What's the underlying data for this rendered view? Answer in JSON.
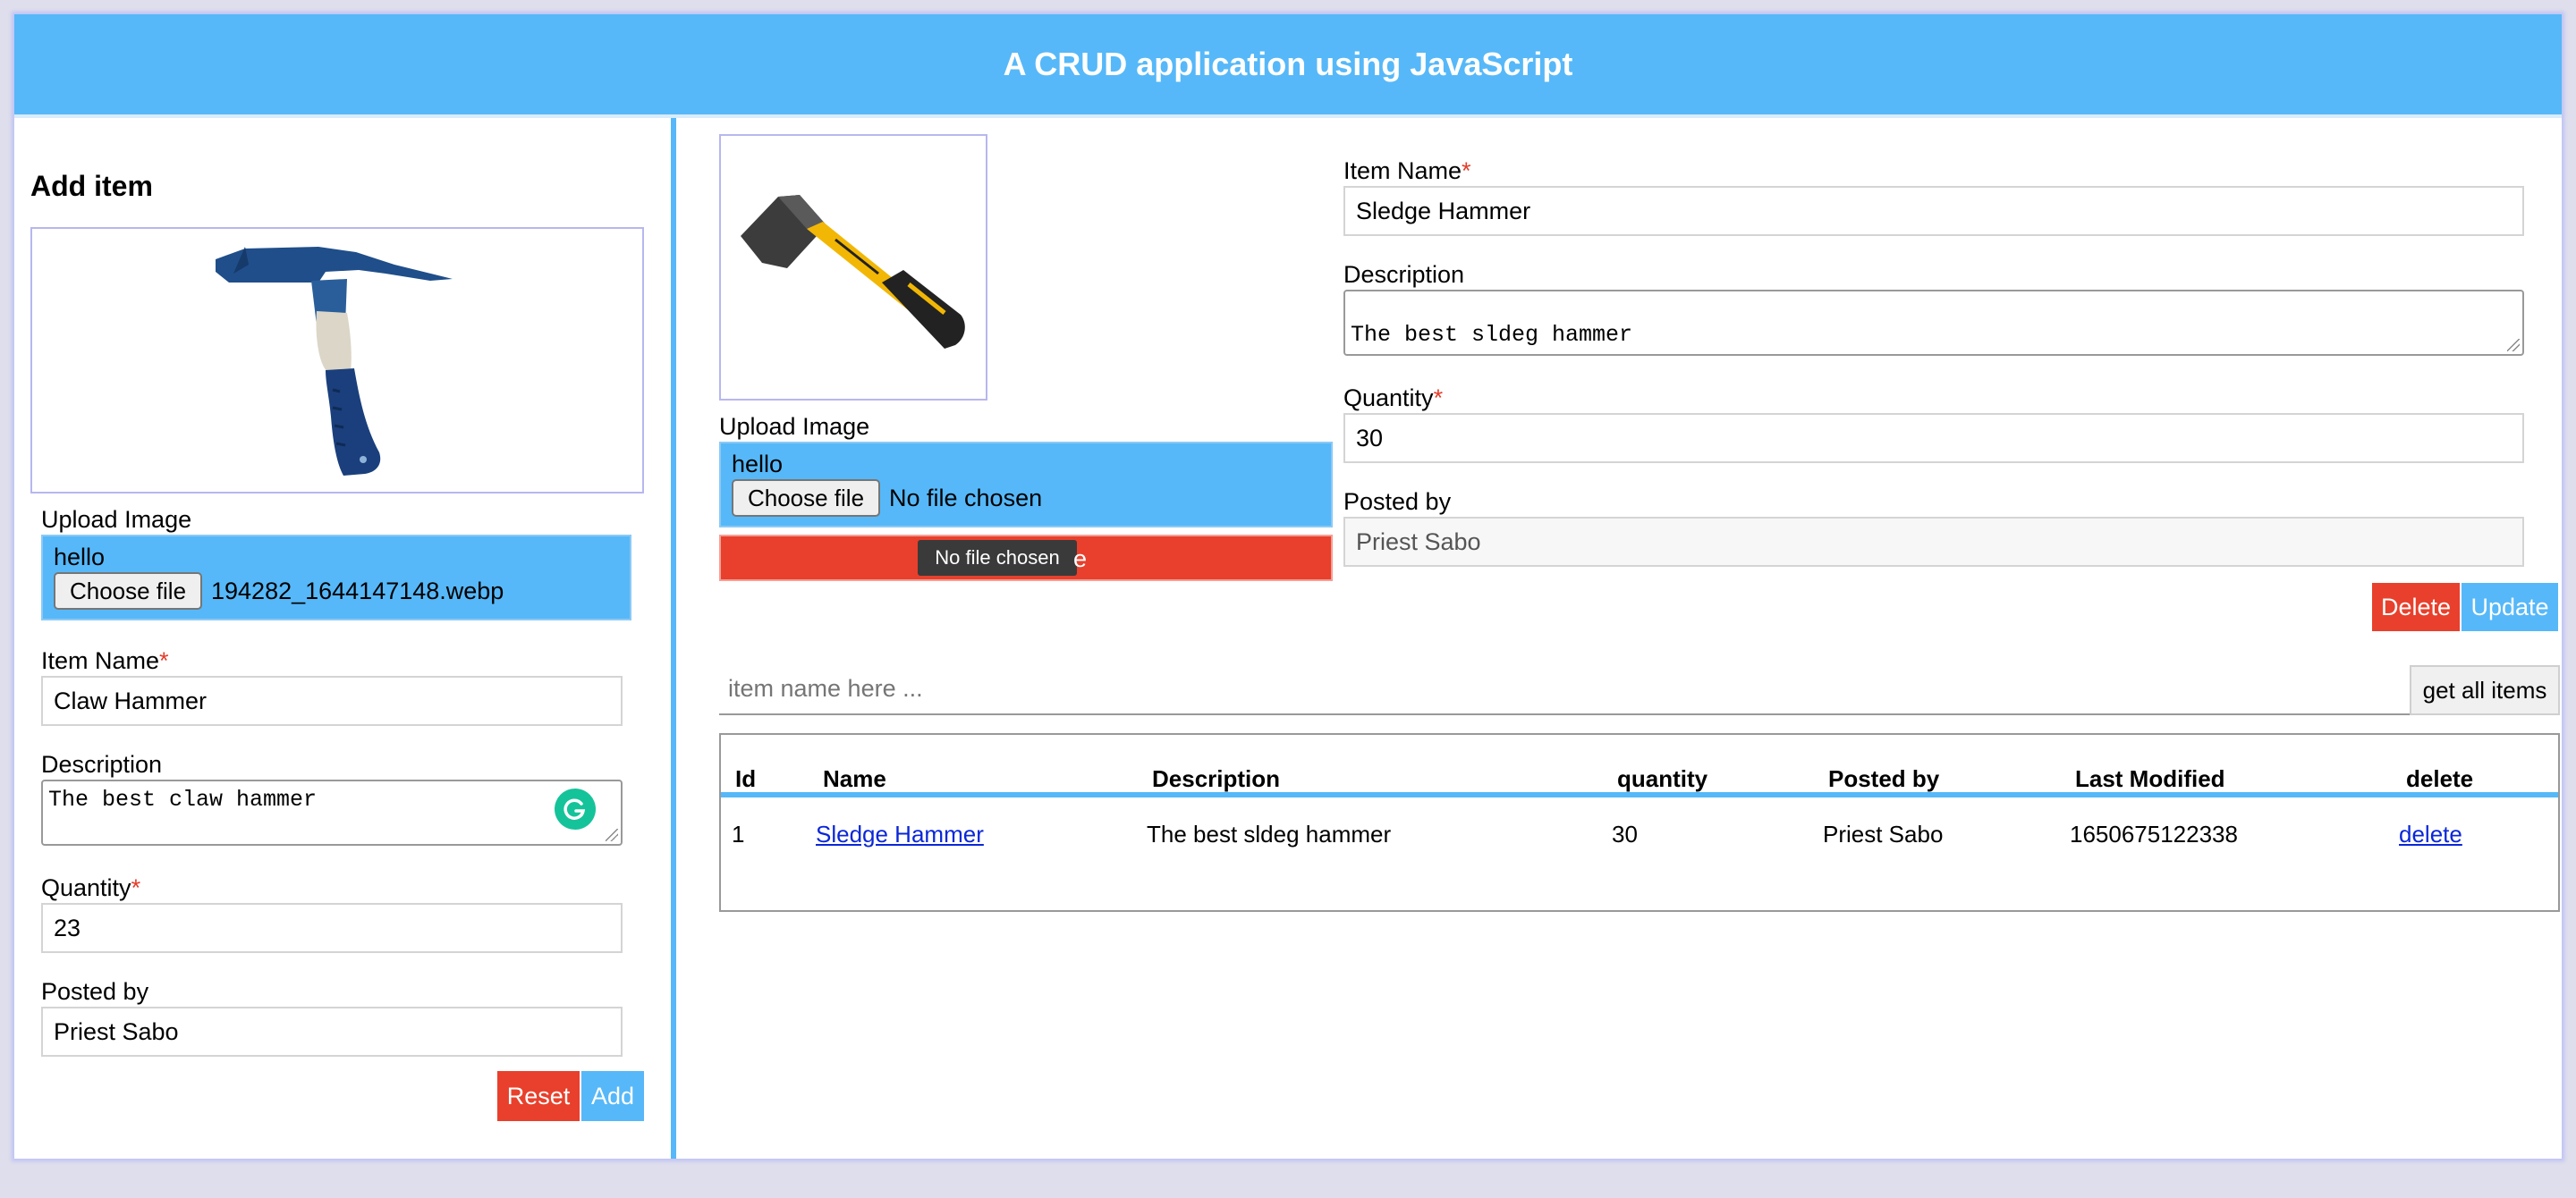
{
  "header": {
    "title": "A CRUD application using JavaScript"
  },
  "colors": {
    "primary": "#56b8f8",
    "danger": "#e8402c",
    "required": "#e23c2a",
    "link": "#0a27d8"
  },
  "add_form": {
    "title": "Add item",
    "image_alt": "claw hammer preview",
    "upload_label": "Upload Image",
    "upload_text": "hello",
    "choose_file": "Choose file",
    "file_name": "194282_1644147148.webp",
    "item_name_label": "Item Name",
    "required_mark": "*",
    "item_name_value": "Claw Hammer",
    "description_label": "Description",
    "description_value": "The best claw hammer",
    "quantity_label": "Quantity",
    "quantity_value": "23",
    "posted_by_label": "Posted by",
    "posted_by_value": "Priest Sabo",
    "reset_label": "Reset",
    "add_label": "Add",
    "grammarly_icon": "grammarly-icon"
  },
  "edit_form": {
    "image_alt": "sledge hammer preview",
    "upload_label": "Upload Image",
    "upload_text": "hello",
    "choose_file": "Choose file",
    "file_name": "No file chosen",
    "tooltip": "No file chosen",
    "item_name_label": "Item Name",
    "required_mark": "*",
    "item_name_value": "Sledge Hammer",
    "description_label": "Description",
    "description_value": "The best sldeg hammer",
    "quantity_label": "Quantity",
    "quantity_value": "30",
    "posted_by_label": "Posted by",
    "posted_by_value": "Priest Sabo",
    "delete_label": "Delete",
    "update_label": "Update"
  },
  "search": {
    "placeholder": "item name here ...",
    "get_all_label": "get all items"
  },
  "table": {
    "headers": [
      "Id",
      "Name",
      "Description",
      "quantity",
      "Posted by",
      "Last Modified",
      "delete"
    ],
    "rows": [
      {
        "id": "1",
        "name": "Sledge Hammer",
        "description": "The best sldeg hammer",
        "quantity": "30",
        "posted_by": "Priest Sabo",
        "last_modified": "1650675122338",
        "delete": "delete"
      }
    ]
  }
}
